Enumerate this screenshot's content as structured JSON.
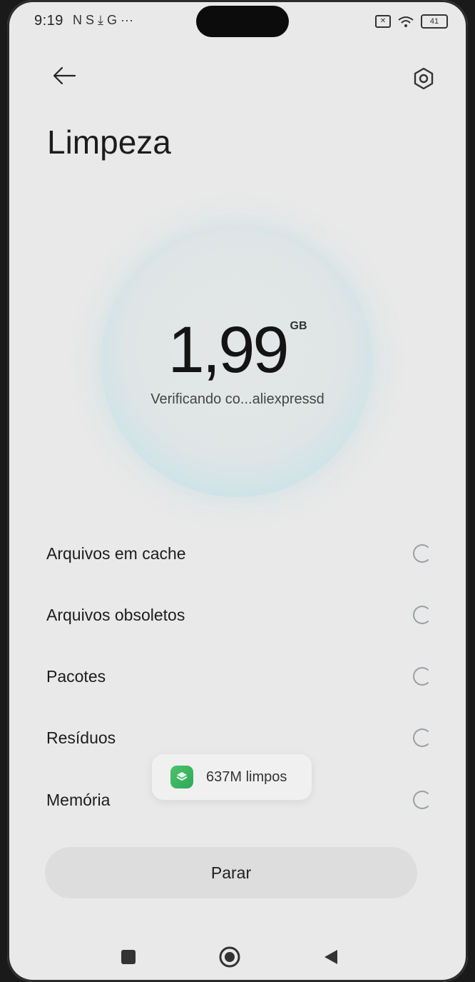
{
  "status_bar": {
    "time": "9:19",
    "notification_glyphs": "N  S  ⤓  G  ···",
    "battery": "41"
  },
  "header": {
    "back_icon": "arrow-left-icon",
    "settings_icon": "hexagon-gear-icon",
    "title": "Limpeza"
  },
  "scan": {
    "size_value": "1,99",
    "size_unit": "GB",
    "status_text": "Verificando co...aliexpressd"
  },
  "items": [
    {
      "label": "Arquivos em cache"
    },
    {
      "label": "Arquivos obsoletos"
    },
    {
      "label": "Pacotes"
    },
    {
      "label": "Resíduos"
    },
    {
      "label": "Memória"
    }
  ],
  "toast": {
    "text": "637M limpos"
  },
  "stop_button": {
    "label": "Parar"
  },
  "nav_bar": {
    "recents_icon": "square-icon",
    "home_icon": "circle-icon",
    "back_icon": "triangle-back-icon"
  },
  "colors": {
    "background": "#e8e9e8",
    "bubble_edge": "#bfdee7",
    "toast_icon": "#3bb562"
  }
}
